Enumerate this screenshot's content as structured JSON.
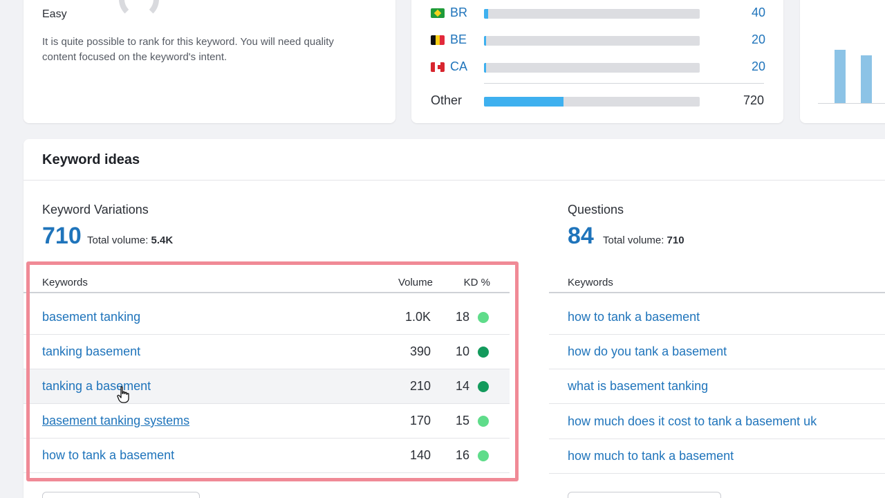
{
  "difficulty": {
    "level": "Easy",
    "description": "It is quite possible to rank for this keyword. You will need quality content focused on the keyword's intent."
  },
  "countries": {
    "rows": [
      {
        "code": "BR",
        "value": "40",
        "share": 0.02
      },
      {
        "code": "BE",
        "value": "20",
        "share": 0.01
      },
      {
        "code": "CA",
        "value": "20",
        "share": 0.01
      }
    ],
    "other": {
      "label": "Other",
      "value": "720",
      "share": 0.37
    }
  },
  "keyword_ideas": {
    "title": "Keyword ideas",
    "variations": {
      "title": "Keyword Variations",
      "count": "710",
      "total_label": "Total volume:",
      "total_value": "5.4K",
      "columns": {
        "keyword": "Keywords",
        "volume": "Volume",
        "kd": "KD %"
      },
      "rows": [
        {
          "keyword": "basement tanking",
          "volume": "1.0K",
          "kd": "18",
          "kd_color": "#5fdc8a"
        },
        {
          "keyword": "tanking basement",
          "volume": "390",
          "kd": "10",
          "kd_color": "#139a5c"
        },
        {
          "keyword": "tanking a basement",
          "volume": "210",
          "kd": "14",
          "kd_color": "#139a5c"
        },
        {
          "keyword": "basement tanking systems",
          "volume": "170",
          "kd": "15",
          "kd_color": "#5fdc8a"
        },
        {
          "keyword": "how to tank a basement",
          "volume": "140",
          "kd": "16",
          "kd_color": "#5fdc8a"
        }
      ]
    },
    "questions": {
      "title": "Questions",
      "count": "84",
      "total_label": "Total volume:",
      "total_value": "710",
      "columns": {
        "keyword": "Keywords"
      },
      "rows": [
        {
          "keyword": "how to tank a basement"
        },
        {
          "keyword": "how do you tank a basement"
        },
        {
          "keyword": "what is basement tanking"
        },
        {
          "keyword": "how much does it cost to tank a basement uk"
        },
        {
          "keyword": "how much to tank a basement"
        }
      ]
    }
  },
  "colors": {
    "link": "#1f74bb",
    "bar": "#3eb0ef",
    "highlight": "#f08a96"
  }
}
